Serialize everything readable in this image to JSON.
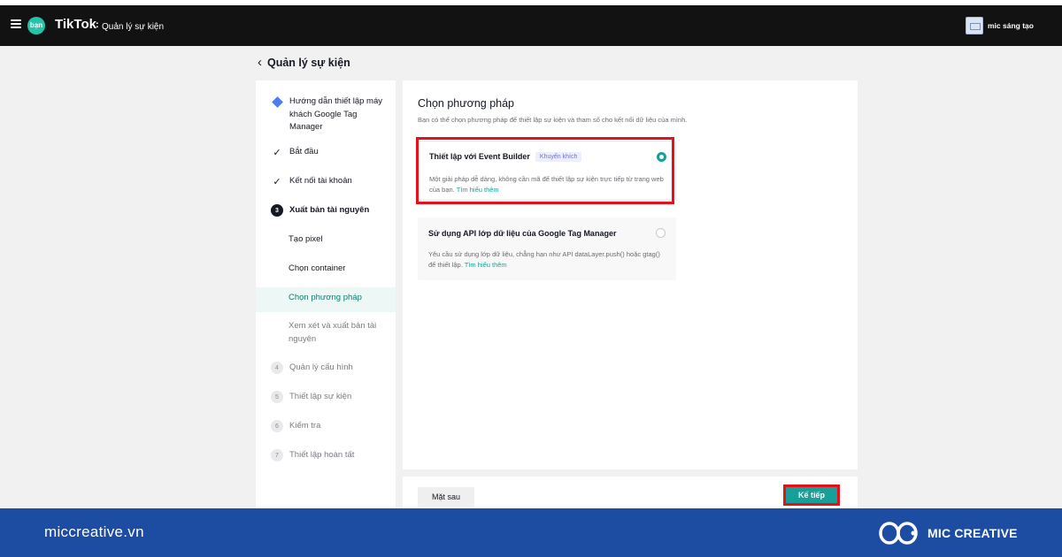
{
  "app": {
    "badge": "bạn",
    "brand": "TikTok",
    "brand_colon": ":",
    "section": "Quản lý sự kiện",
    "account_name": "mic sáng tạo"
  },
  "page": {
    "back_title": "Quản lý sự kiện"
  },
  "sidebar": {
    "steps": [
      {
        "label": "Hướng dẫn thiết lập máy khách Google Tag Manager",
        "icon": "diamond-icon"
      },
      {
        "label": "Bắt đầu",
        "icon": "check-icon"
      },
      {
        "label": "Kết nối tài khoản",
        "icon": "check-icon"
      },
      {
        "label": "Xuất bản tài nguyên",
        "icon": "step-number",
        "number": "3"
      },
      {
        "label": "Quản lý cấu hình",
        "icon": "step-number",
        "number": "4"
      },
      {
        "label": "Thiết lập sự kiện",
        "icon": "step-number",
        "number": "5"
      },
      {
        "label": "Kiểm tra",
        "icon": "step-number",
        "number": "6"
      },
      {
        "label": "Thiết lập hoàn tất",
        "icon": "step-number",
        "number": "7"
      }
    ],
    "substeps": [
      {
        "label": "Tạo pixel"
      },
      {
        "label": "Chọn container"
      },
      {
        "label": "Chọn phương pháp",
        "active": true
      },
      {
        "label": "Xem xét và xuất bản tài nguyên"
      }
    ]
  },
  "main": {
    "title": "Chọn phương pháp",
    "description": "Bạn có thể chọn phương pháp để thiết lập sự kiện và tham số cho kết nối dữ liệu của mình.",
    "options": [
      {
        "title": "Thiết lập với Event Builder",
        "tag": "Khuyến khích",
        "description": "Một giải pháp dễ dàng, không cần mã để thiết lập sự kiện trực tiếp từ trang web của bạn.",
        "link": "Tìm hiểu thêm",
        "selected": true
      },
      {
        "title": "Sử dụng API lớp dữ liệu của Google Tag Manager",
        "description": "Yêu cầu sử dụng lớp dữ liệu, chẳng hạn như API dataLayer.push() hoặc gtag() để thiết lập.",
        "link": "Tìm hiểu thêm",
        "selected": false
      }
    ]
  },
  "footer": {
    "prev_label": "Mặt sau",
    "next_label": "Kế tiếp"
  },
  "banner": {
    "site": "miccreative.vn",
    "logo_text": "MIC CREATIVE"
  },
  "colors": {
    "accent": "#16a097",
    "highlight": "#e2111a",
    "banner": "#1d4da3",
    "topbar": "#121212"
  }
}
